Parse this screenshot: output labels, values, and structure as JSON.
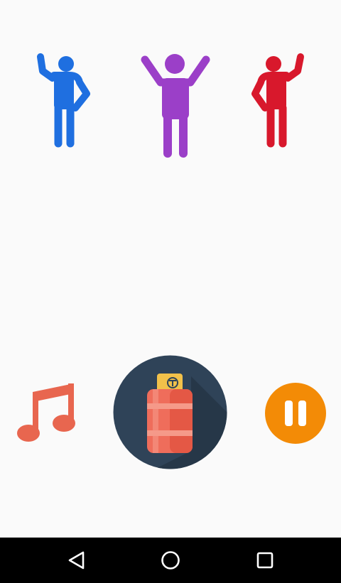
{
  "figures": [
    {
      "icon": "person-raising-left-hand-icon",
      "color": "#1f6fe0"
    },
    {
      "icon": "person-raising-both-hands-icon",
      "color": "#9b3fc8"
    },
    {
      "icon": "person-raising-right-hand-icon",
      "color": "#d8182c"
    }
  ],
  "controls": {
    "music": {
      "icon": "music-note-icon",
      "color": "#e8664f"
    },
    "main": {
      "icon": "gas-cylinder-icon",
      "background": "#2f4358",
      "cylinder_color": "#ef6d5b",
      "valve_color": "#f2c14a"
    },
    "pause": {
      "icon": "pause-icon",
      "color": "#f38b06"
    }
  },
  "navbar": {
    "back": {
      "icon": "back-triangle-icon"
    },
    "home": {
      "icon": "home-circle-icon"
    },
    "recents": {
      "icon": "recents-square-icon"
    }
  }
}
